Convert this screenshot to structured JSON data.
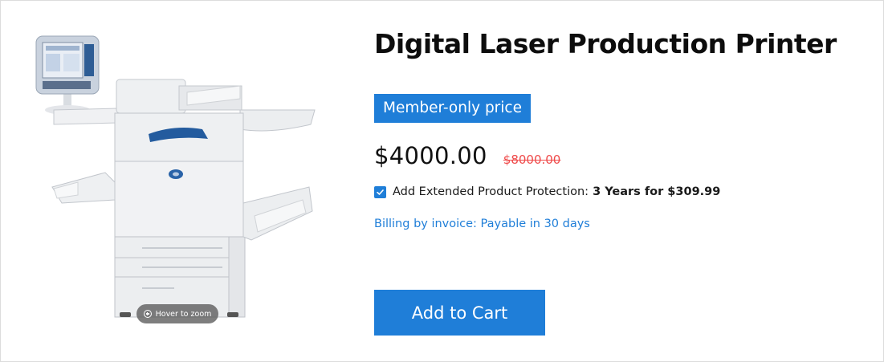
{
  "product": {
    "title": "Digital Laser Production Printer",
    "badge": "Member-only price",
    "price": "$4000.00",
    "old_price": "$8000.00",
    "protection": {
      "checked": true,
      "label": "Add Extended Product Protection:",
      "offer": "3 Years for $309.99"
    },
    "billing": "Billing by invoice: Payable in 30 days",
    "add_to_cart_label": "Add to Cart"
  },
  "media": {
    "zoom_hint": "Hover to zoom",
    "zoom_icon": "zoom-in-icon"
  },
  "colors": {
    "accent": "#1f7ed8",
    "sale_red": "#ef4b4b",
    "text": "#111111"
  }
}
